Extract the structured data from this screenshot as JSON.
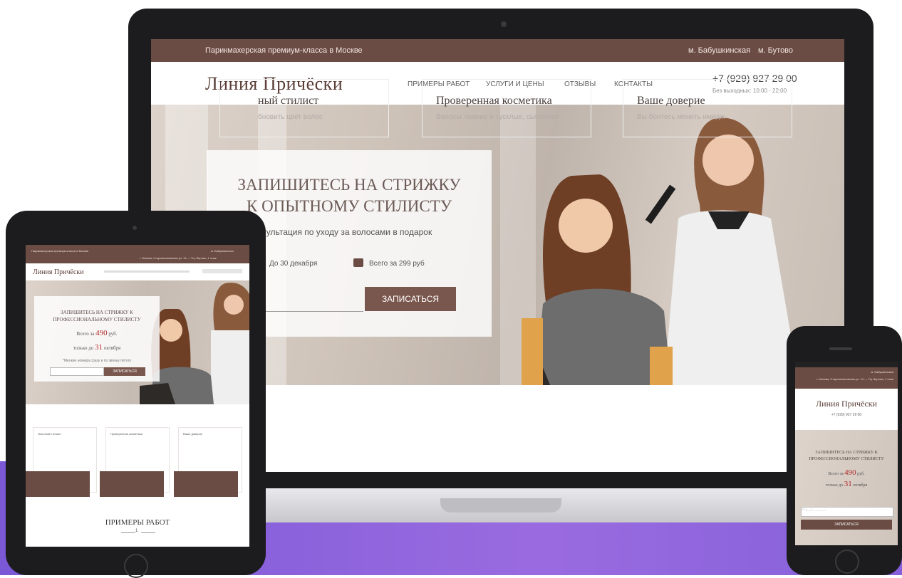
{
  "colors": {
    "brand_brown": "#6b4c44",
    "button_brown": "#7a574e",
    "accent_red": "#b02a2a",
    "background_purple": "#8a60dc"
  },
  "laptop": {
    "topbar": {
      "tagline": "Парикмахерская премиум-класса в Москве",
      "metro_1": "м. Бабушкинская",
      "metro_2": "м. Бутово"
    },
    "header": {
      "logo": "Линия Причёски",
      "menu": [
        "Примеры работ",
        "Услуги и цены",
        "Отзывы",
        "Контакты"
      ],
      "phone": "+7 (929) 927 29 00",
      "hours": "Без выходных: 10:00 - 22:00"
    },
    "hero": {
      "headline_1": "ЗАПИШИТЕСЬ НА СТРИЖКУ",
      "headline_2": "К ОПЫТНОМУ СТИЛИСТУ",
      "subtitle": "ультация по уходу за волосами в подарок",
      "deadline": "До 30 декабря",
      "price": "Всего за 299 руб",
      "input_placeholder": "",
      "cta": "ЗАПИСАТЬСЯ"
    },
    "features": [
      {
        "title": "ный стилист",
        "text": "бновить цвет волос"
      },
      {
        "title": "Проверенная косметика",
        "text": "Волосы ломкие и тусклые, сыплются"
      },
      {
        "title": "Ваше доверие",
        "text": "Вы боитесь менять имидж"
      }
    ]
  },
  "tablet": {
    "topbar": {
      "tagline": "Парикмахерская премиум-класса в Москве",
      "metro": "м. Бабушкинская",
      "address": "г. Москва, Старокачаловская ул. 14 — ТЦ «Бутово, 1 этаж"
    },
    "header": {
      "logo": "Линия Причёски"
    },
    "hero": {
      "headline_1": "ЗАПИШИТЕСЬ НА СТРИЖКУ К",
      "headline_2": "ПРОФЕССИОНАЛЬНОМУ СТИЛИСТУ",
      "price_prefix": "Всего за",
      "price_value": "490",
      "price_suffix": "руб.",
      "deadline_prefix": "только до",
      "deadline_value": "31",
      "deadline_suffix": "октября",
      "note": "*Мелкие номера сразу и по звонку пятого",
      "cta": "ЗАПИСАТЬСЯ"
    },
    "features": [
      "Опытный стилист",
      "Проверенная косметика",
      "Ваше доверие"
    ],
    "section_title": "ПРИМЕРЫ РАБОТ",
    "section_counter": "1"
  },
  "phone": {
    "topbar": {
      "metro": "м. Бабушкинская",
      "address": "г. Москва, Старокачаловская ул. 14 — ТЦ «Бутово, 1 этаж"
    },
    "header": {
      "logo": "Линия Причёски",
      "phone": "+7 (929) 927 29 00"
    },
    "hero": {
      "headline_1": "ЗАПИШИТЕСЬ НА СТРИЖКУ К",
      "headline_2": "ПРОФЕССИОНАЛЬНОМУ СТИЛИСТУ",
      "price_prefix": "Всего за",
      "price_value": "490",
      "price_suffix": "руб.",
      "deadline_prefix": "только до",
      "deadline_value": "31",
      "deadline_suffix": "октября",
      "input_placeholder": "+7 (___) ___-__-__",
      "cta": "ЗАПИСАТЬСЯ"
    }
  }
}
